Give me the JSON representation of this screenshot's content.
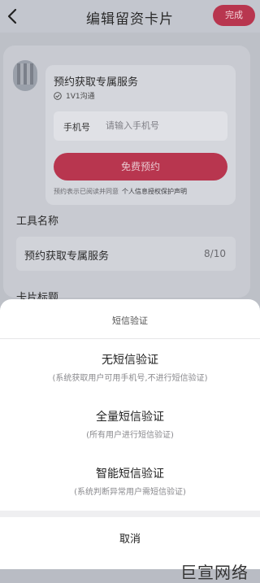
{
  "header": {
    "title": "编辑留资卡片",
    "done_label": "完成"
  },
  "card": {
    "service_title": "预约获取专属服务",
    "consult_badge": "1V1沟通",
    "phone_label": "手机号",
    "phone_placeholder": "请输入手机号",
    "book_button": "免费预约",
    "notice_text": "预约表示已阅读并同意",
    "notice_link": "个人信息授权保护声明"
  },
  "form": {
    "tool_name_label": "工具名称",
    "tool_name_value": "预约获取专属服务",
    "tool_name_count": "8/10",
    "card_title_label": "卡片标题"
  },
  "sheet": {
    "title": "短信验证",
    "options": [
      {
        "title": "无短信验证",
        "subtitle": "(系统获取用户可用手机号,不进行短信验证)"
      },
      {
        "title": "全量短信验证",
        "subtitle": "(所有用户进行短信验证)"
      },
      {
        "title": "智能短信验证",
        "subtitle": "(系统判断异常用户需短信验证)"
      }
    ],
    "cancel": "取消"
  },
  "watermark": "巨宣网络",
  "colors": {
    "accent": "#b8364f",
    "overlay": "#b9bcc4",
    "sheet": "#ffffff"
  }
}
